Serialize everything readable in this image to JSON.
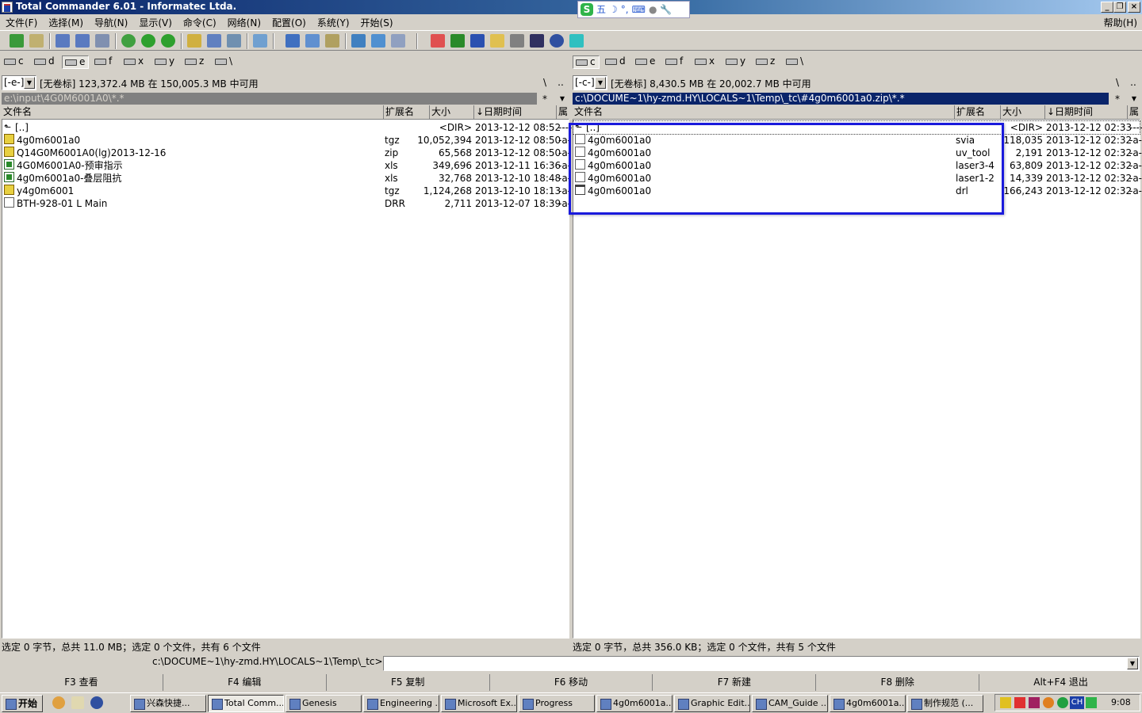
{
  "window": {
    "title": "Total Commander 6.01 - Informatec Ltda."
  },
  "ime": {
    "label": "五",
    "items": [
      "S-icon",
      "moon-icon",
      "dot-icon",
      "keyboard-icon",
      "user-icon",
      "wrench-icon"
    ]
  },
  "menu": {
    "items": [
      "文件(F)",
      "选择(M)",
      "导航(N)",
      "显示(V)",
      "命令(C)",
      "网络(N)",
      "配置(O)",
      "系统(Y)",
      "开始(S)"
    ],
    "help": "帮助(H)"
  },
  "left": {
    "drives": [
      "c",
      "d",
      "e",
      "f",
      "x",
      "y",
      "z",
      "\\"
    ],
    "active_drive": "e",
    "combo": "[-e-]",
    "free": "[无卷标]  123,372.4 MB 在 150,005.3 MB 中可用",
    "root_btn": "\\",
    "up_btn": "..",
    "path": "e:\\input\\4G0M6001A0\\*.*",
    "star": "*",
    "headers": {
      "name": "文件名",
      "ext": "扩展名",
      "size": "大小",
      "date": "↓日期时间",
      "attr": "属"
    },
    "rows": [
      {
        "icon": "up",
        "name": "[..]",
        "ext": "",
        "size": "<DIR>",
        "date": "2013-12-12 08:52",
        "attr": "----"
      },
      {
        "icon": "arc",
        "name": "4g0m6001a0",
        "ext": "tgz",
        "size": "10,052,394",
        "date": "2013-12-12 08:50",
        "attr": "-a-"
      },
      {
        "icon": "arc",
        "name": "Q14G0M6001A0(lg)2013-12-16",
        "ext": "zip",
        "size": "65,568",
        "date": "2013-12-12 08:50",
        "attr": "-a-"
      },
      {
        "icon": "xls",
        "name": "4G0M6001A0-预审指示",
        "ext": "xls",
        "size": "349,696",
        "date": "2013-12-11 16:36",
        "attr": "-a-"
      },
      {
        "icon": "xls",
        "name": "4g0m6001a0-叠层阻抗",
        "ext": "xls",
        "size": "32,768",
        "date": "2013-12-10 18:48",
        "attr": "-a-"
      },
      {
        "icon": "arc",
        "name": "y4g0m6001",
        "ext": "tgz",
        "size": "1,124,268",
        "date": "2013-12-10 18:13",
        "attr": "-a-"
      },
      {
        "icon": "doc",
        "name": "BTH-928-01 L Main",
        "ext": "DRR",
        "size": "2,711",
        "date": "2013-12-07 18:39",
        "attr": "-a-"
      }
    ],
    "status": "选定 0 字节，总共 11.0 MB；选定 0 个文件，共有 6 个文件"
  },
  "right": {
    "drives": [
      "c",
      "d",
      "e",
      "f",
      "x",
      "y",
      "z",
      "\\"
    ],
    "active_drive": "c",
    "combo": "[-c-]",
    "free": "[无卷标]  8,430.5 MB 在 20,002.7 MB 中可用",
    "root_btn": "\\",
    "up_btn": "..",
    "path": "c:\\DOCUME~1\\hy-zmd.HY\\LOCALS~1\\Temp\\_tc\\#4g0m6001a0.zip\\*.*",
    "star": "*",
    "headers": {
      "name": "文件名",
      "ext": "扩展名",
      "size": "大小",
      "date": "↓日期时间",
      "attr": "属"
    },
    "rows": [
      {
        "icon": "up",
        "name": "[..]",
        "ext": "",
        "size": "<DIR>",
        "date": "2013-12-12 02:33",
        "attr": "----"
      },
      {
        "icon": "doc",
        "name": "4g0m6001a0",
        "ext": "svia",
        "size": "118,035",
        "date": "2013-12-12 02:32",
        "attr": "-a-"
      },
      {
        "icon": "doc",
        "name": "4g0m6001a0",
        "ext": "uv_tool",
        "size": "2,191",
        "date": "2013-12-12 02:32",
        "attr": "-a-"
      },
      {
        "icon": "doc",
        "name": "4g0m6001a0",
        "ext": "laser3-4",
        "size": "63,809",
        "date": "2013-12-12 02:32",
        "attr": "-a-"
      },
      {
        "icon": "doc",
        "name": "4g0m6001a0",
        "ext": "laser1-2",
        "size": "14,339",
        "date": "2013-12-12 02:32",
        "attr": "-a-"
      },
      {
        "icon": "drl",
        "name": "4g0m6001a0",
        "ext": "drl",
        "size": "166,243",
        "date": "2013-12-12 02:32",
        "attr": "-a-"
      }
    ],
    "status": "选定 0 字节，总共 356.0 KB；选定 0 个文件，共有 5 个文件"
  },
  "command": {
    "path": "c:\\DOCUME~1\\hy-zmd.HY\\LOCALS~1\\Temp\\_tc>",
    "value": ""
  },
  "fkeys": [
    "F3 查看",
    "F4 编辑",
    "F5 复制",
    "F6 移动",
    "F7 新建",
    "F8 删除",
    "Alt+F4 退出"
  ],
  "taskbar": {
    "start": "开始",
    "tasks": [
      "兴森快捷...",
      "Total Comm...",
      "Genesis",
      "Engineering ...",
      "Microsoft Ex...",
      "Progress",
      "4g0m6001a...",
      "Graphic Edit...",
      "CAM_Guide ...",
      "4g0m6001a...",
      "制作规范 (..."
    ],
    "active_index": 1,
    "tray_lang": "CH",
    "clock": "9:08"
  },
  "colors": {
    "title_start": "#0a246a",
    "path_active": "#0a246a",
    "path_inactive": "#808080",
    "highlight_box": "#1a1adc"
  }
}
